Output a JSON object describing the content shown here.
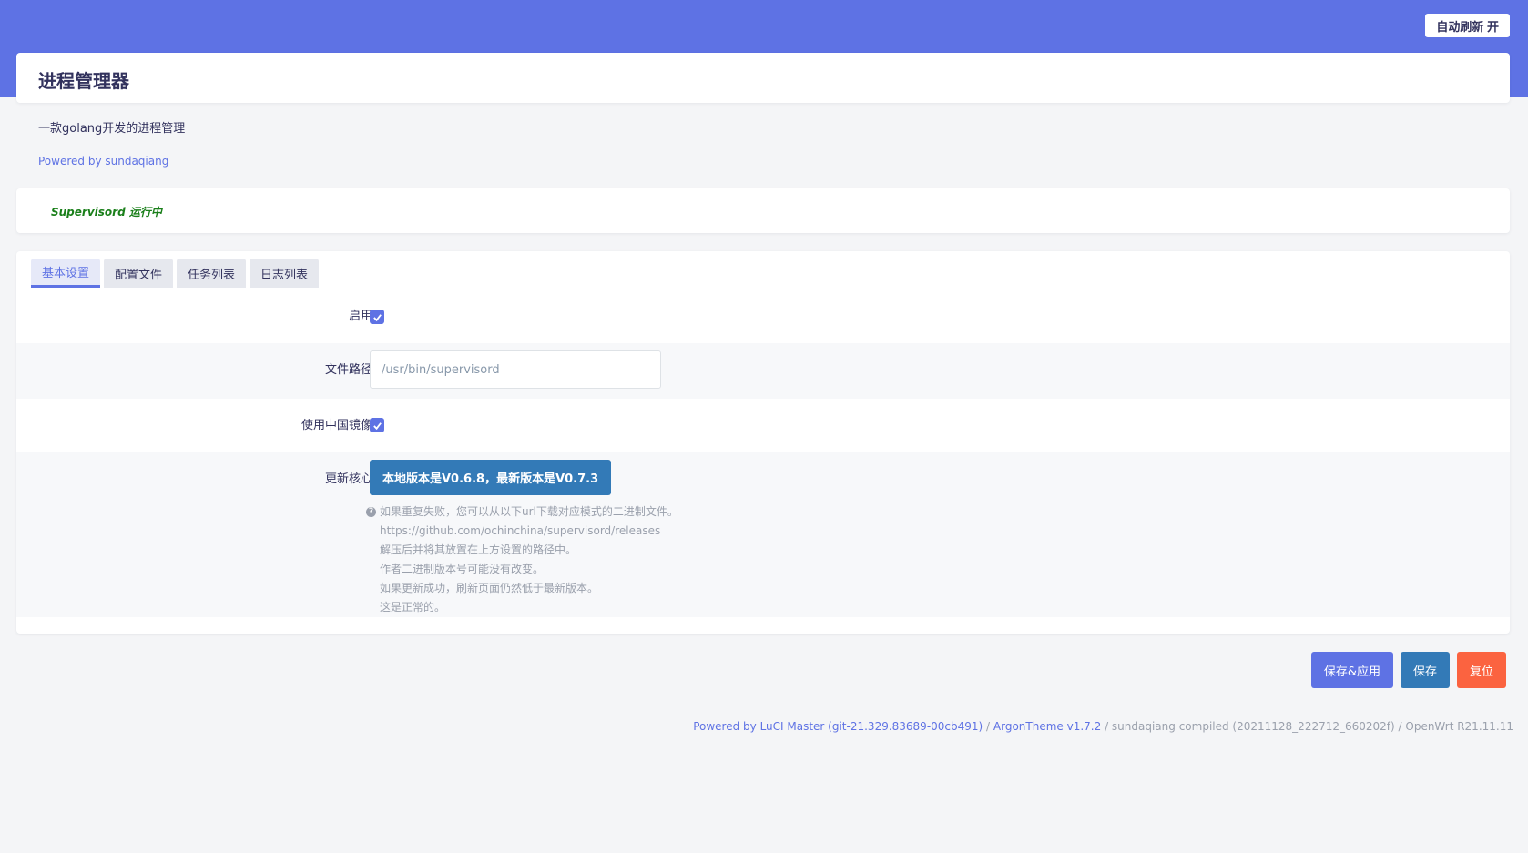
{
  "header": {
    "refresh_button": "自动刷新 开"
  },
  "page": {
    "title": "进程管理器",
    "description": "一款golang开发的进程管理",
    "powered_by": "Powered by sundaqiang"
  },
  "status": {
    "text": "Supervisord 运行中"
  },
  "tabs": [
    {
      "label": "基本设置",
      "active": true
    },
    {
      "label": "配置文件",
      "active": false
    },
    {
      "label": "任务列表",
      "active": false
    },
    {
      "label": "日志列表",
      "active": false
    }
  ],
  "form": {
    "enable": {
      "label": "启用",
      "checked": true
    },
    "file_path": {
      "label": "文件路径",
      "placeholder": "/usr/bin/supervisord"
    },
    "china_mirror": {
      "label": "使用中国镜像",
      "checked": true
    },
    "update_core": {
      "label": "更新核心",
      "button": "本地版本是V0.6.8，最新版本是V0.7.3",
      "help_lines": [
        "如果重复失败，您可以从以下url下载对应模式的二进制文件。",
        "https://github.com/ochinchina/supervisord/releases",
        "解压后并将其放置在上方设置的路径中。",
        "作者二进制版本号可能没有改变。",
        "如果更新成功，刷新页面仍然低于最新版本。",
        "这是正常的。"
      ]
    }
  },
  "actions": {
    "save_apply": "保存&应用",
    "save": "保存",
    "reset": "复位"
  },
  "footer": {
    "luci_link": "Powered by LuCI Master (git-21.329.83689-00cb491)",
    "sep1": " / ",
    "theme_link": "ArgonTheme v1.7.2",
    "rest": " / sundaqiang compiled (20211128_222712_660202f) / OpenWrt R21.11.11"
  },
  "colors": {
    "accent": "#5e72e4",
    "primary_button": "#337ab7",
    "reset_button": "#fb6340",
    "status_running": "#1a7f1a"
  }
}
